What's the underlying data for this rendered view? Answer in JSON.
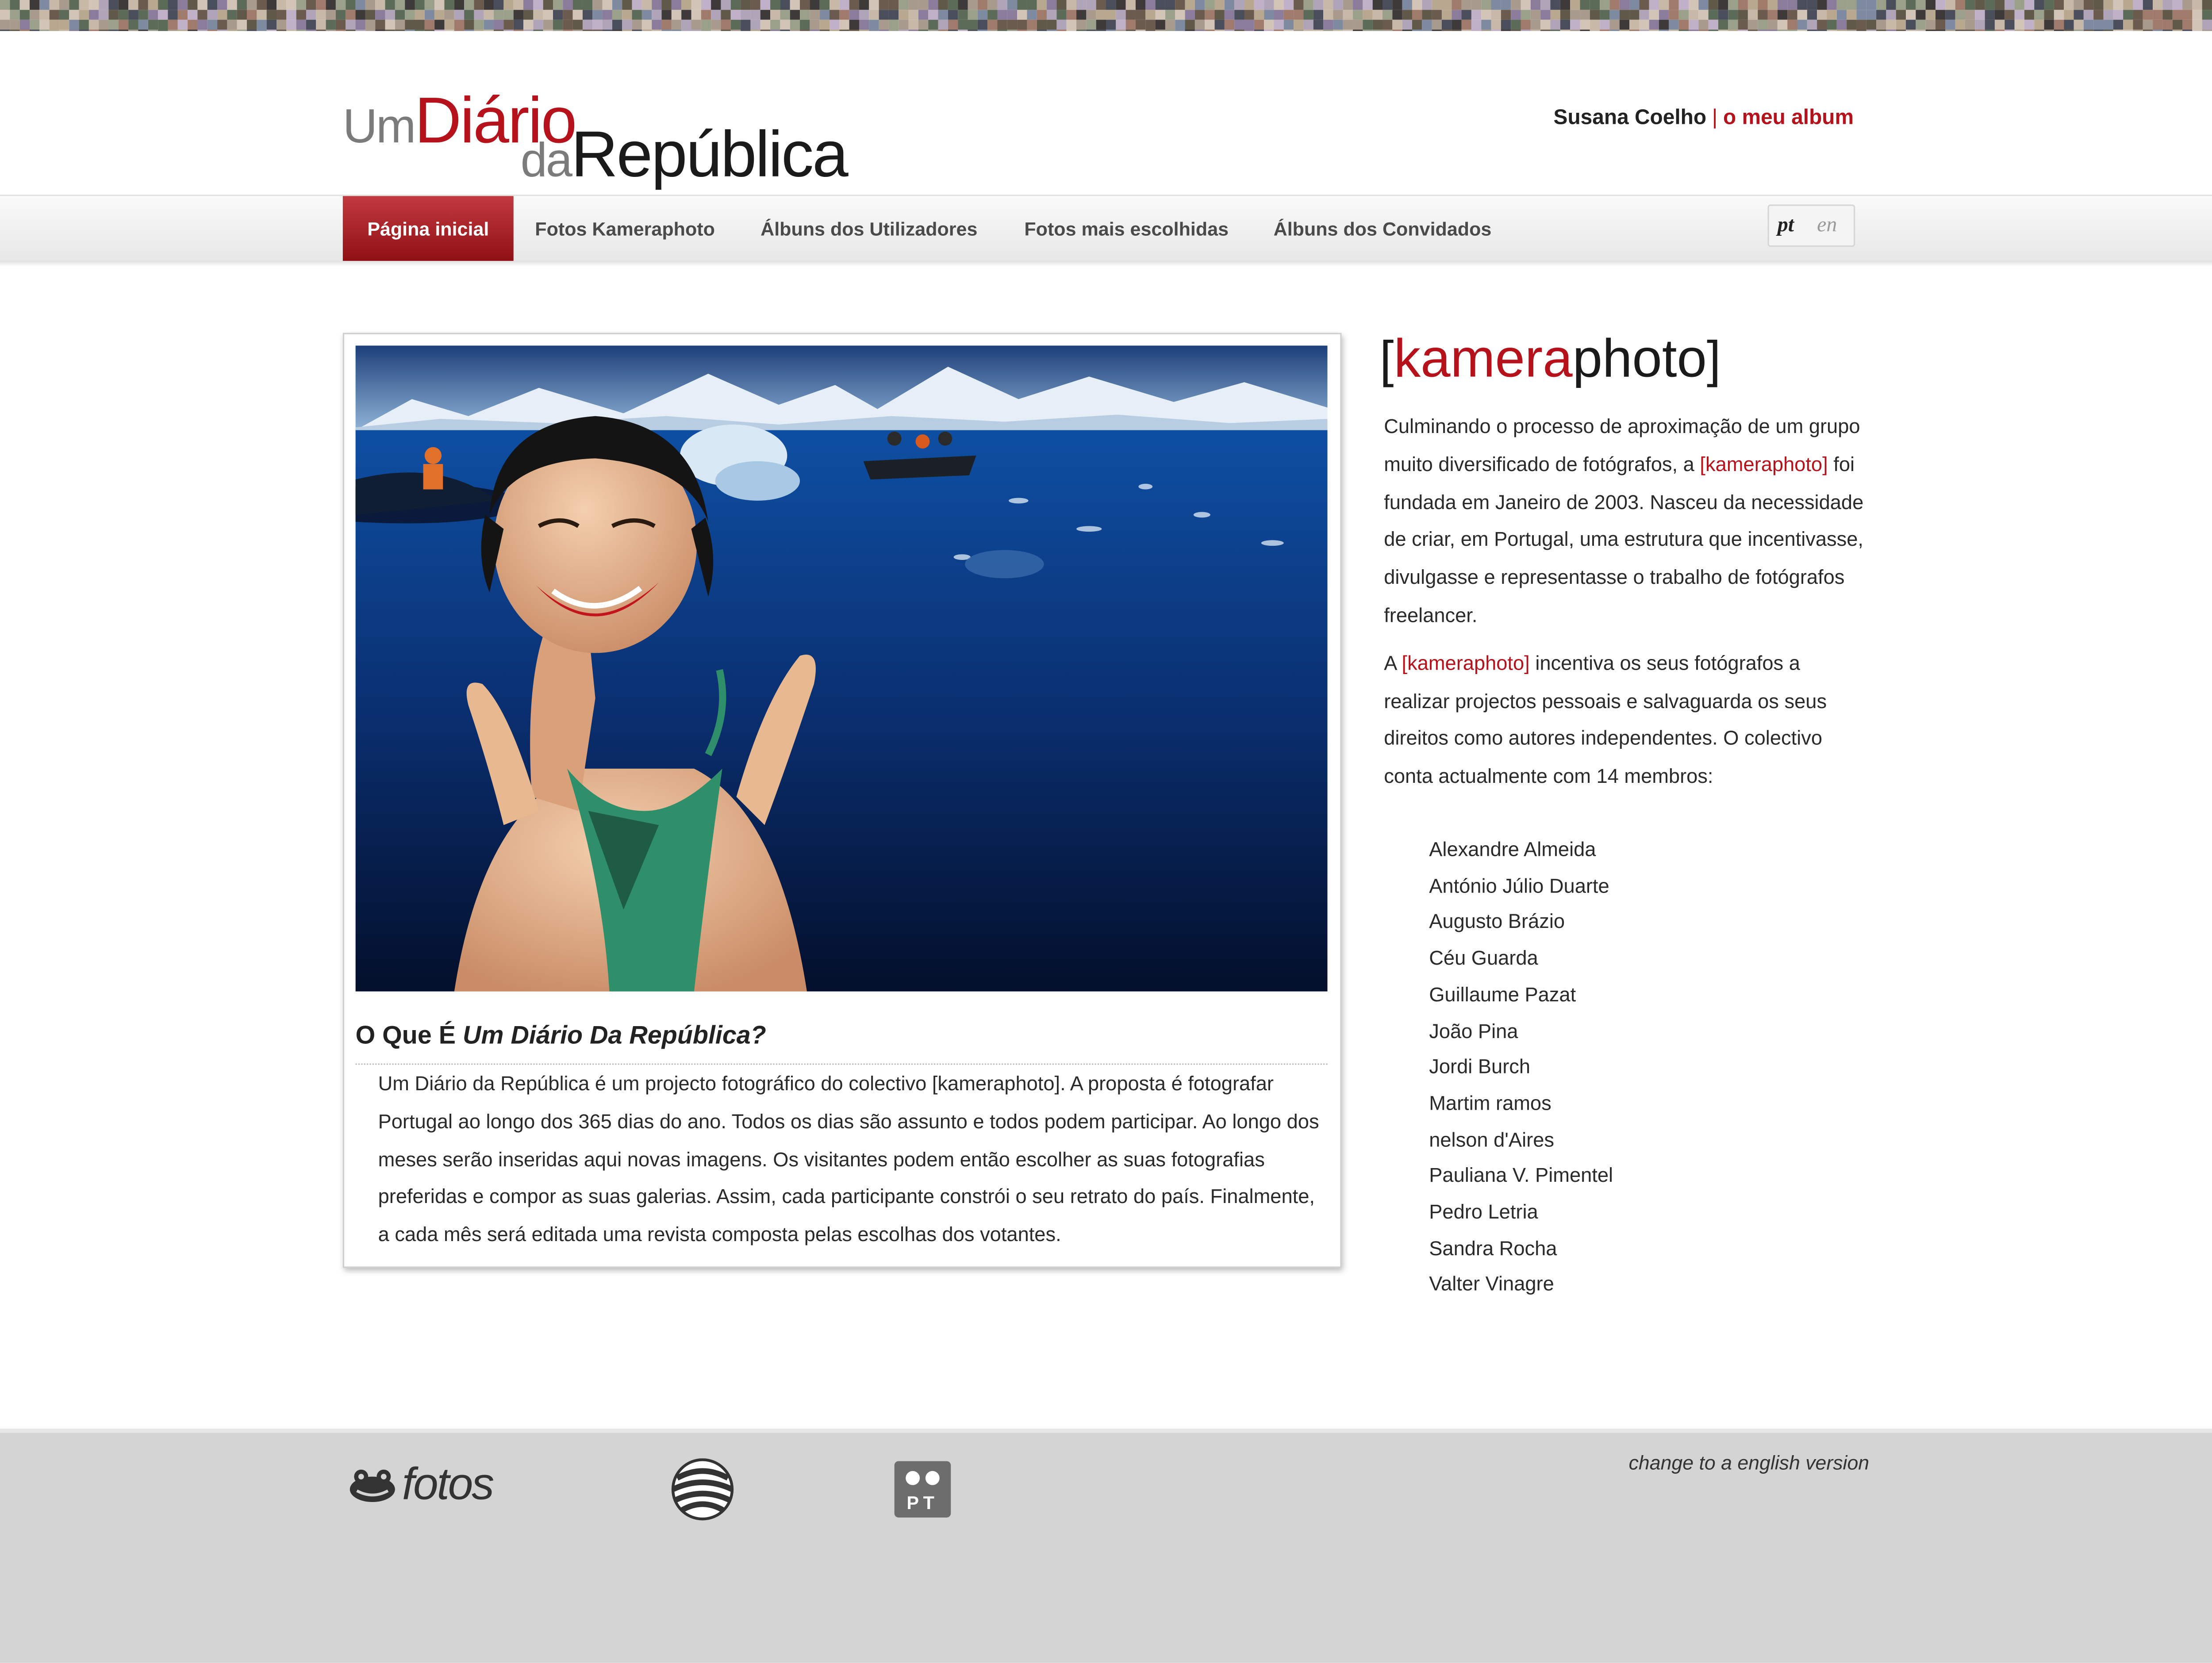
{
  "header": {
    "logo": {
      "part1": "Um",
      "part2": "Diário",
      "part3": "da",
      "part4": "República"
    },
    "user_name": "Susana Coelho",
    "separator": "|",
    "my_album": "o meu album"
  },
  "nav": {
    "items": [
      {
        "label": "Página inicial",
        "active": true
      },
      {
        "label": "Fotos Kameraphoto",
        "active": false
      },
      {
        "label": "Álbuns dos Utilizadores",
        "active": false
      },
      {
        "label": "Fotos mais escolhidas",
        "active": false
      },
      {
        "label": "Álbuns dos Convidados",
        "active": false
      }
    ],
    "lang": {
      "pt": "pt",
      "en": "en"
    }
  },
  "main": {
    "title_prefix": "O Que É",
    "title_italic": "Um Diário Da República?",
    "description": "Um Diário da República é um projecto fotográfico do colectivo [kameraphoto]. A proposta é fotografar Portugal ao longo dos 365 dias do ano. Todos os dias são assunto e todos podem participar. Ao longo dos meses serão inseridas aqui novas imagens. Os visitantes podem então escolher as suas fotografias preferidas e compor as suas galerias. Assim, cada participante constrói o seu retrato do país. Finalmente, a cada mês será editada uma revista composta pelas escolhas dos votantes."
  },
  "sidebar": {
    "logo": {
      "open": "[",
      "red": "kamera",
      "black": "photo",
      "close": "]"
    },
    "para1_before": "Culminando o processo de aproximação de um grupo muito diversificado de fotógrafos, a",
    "para1_link": "[kameraphoto]",
    "para1_after": "foi fundada em Janeiro de 2003. Nasceu da necessidade de criar, em Portugal, uma estrutura que incentivasse, divulgasse e representasse o trabalho de fotógrafos freelancer.",
    "para2_before": "A",
    "para2_link": "[kameraphoto]",
    "para2_after": "incentiva os seus fotógrafos a realizar projectos pessoais e salvaguarda os seus direitos como autores independentes. O colectivo conta actualmente com 14 membros:",
    "members": [
      "Alexandre Almeida",
      "António Júlio Duarte",
      "Augusto Brázio",
      "Céu Guarda",
      "Guillaume Pazat",
      "João Pina",
      "Jordi Burch",
      "Martim ramos",
      "nelson d'Aires",
      "Pauliana V. Pimentel",
      "Pedro Letria",
      "Sandra Rocha",
      "Valter Vinagre"
    ]
  },
  "footer": {
    "fotos_label": "fotos",
    "pt_badge": "PT",
    "english_link": "change to a english version"
  },
  "colors": {
    "accent": "#b5121b",
    "footer_bg": "#d4d4d4",
    "nav_active": "#a3171d"
  }
}
